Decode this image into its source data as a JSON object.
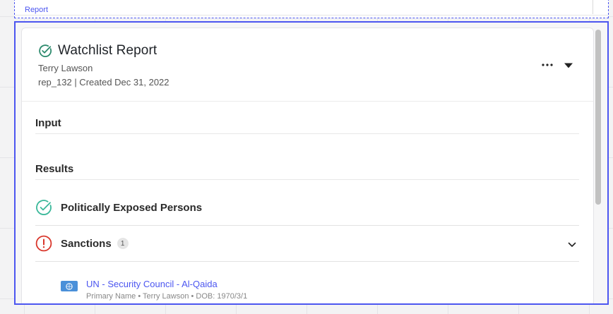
{
  "frame": {
    "label": "Report"
  },
  "report": {
    "title": "Watchlist Report",
    "subject": "Terry Lawson",
    "meta": "rep_132 | Created Dec 31, 2022"
  },
  "sections": {
    "input": "Input",
    "results": "Results"
  },
  "results": [
    {
      "label": "Politically Exposed Persons",
      "status": "passed",
      "status_color": "#3bb89a"
    },
    {
      "label": "Sanctions",
      "status": "flagged",
      "count": "1",
      "status_color": "#d9362b"
    }
  ],
  "match": {
    "title": "UN - Security Council - Al-Qaida",
    "detail": "Primary Name • Terry Lawson • DOB: 1970/3/1"
  },
  "colors": {
    "accent": "#4c56f0",
    "success": "#2e8b6e",
    "danger": "#d9362b",
    "flag": "#4a90d9"
  }
}
